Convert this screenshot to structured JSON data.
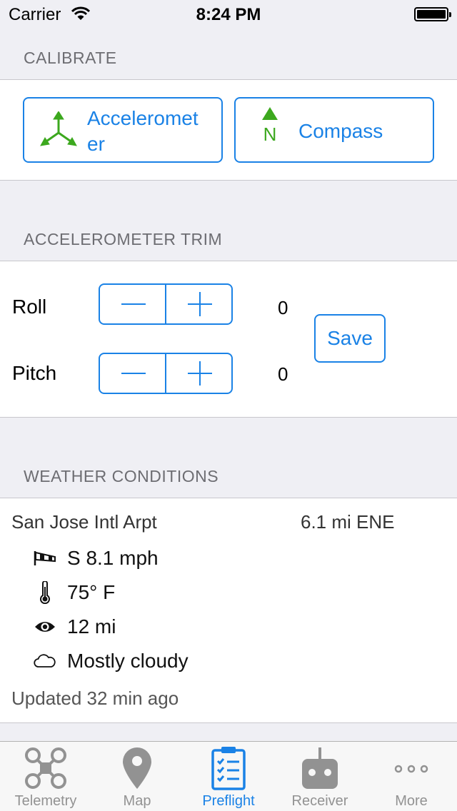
{
  "status_bar": {
    "carrier": "Carrier",
    "time": "8:24 PM"
  },
  "calibrate": {
    "header": "CALIBRATE",
    "accelerometer_line1": "Acceleromet",
    "accelerometer_line2": "er",
    "compass_label": "Compass",
    "compass_icon_letter": "N"
  },
  "trim": {
    "header": "ACCELEROMETER TRIM",
    "roll_label": "Roll",
    "roll_value": "0",
    "pitch_label": "Pitch",
    "pitch_value": "0",
    "save_label": "Save"
  },
  "weather": {
    "header": "WEATHER CONDITIONS",
    "station": "San Jose Intl Arpt",
    "distance": "6.1 mi ENE",
    "wind": "S 8.1 mph",
    "temperature": "75° F",
    "visibility": "12 mi",
    "sky": "Mostly cloudy",
    "updated": "Updated 32 min ago"
  },
  "tabs": [
    {
      "label": "Telemetry",
      "icon": "drone-icon"
    },
    {
      "label": "Map",
      "icon": "map-pin-icon"
    },
    {
      "label": "Preflight",
      "icon": "checklist-icon"
    },
    {
      "label": "Receiver",
      "icon": "remote-control-icon"
    },
    {
      "label": "More",
      "icon": "more-dots-icon"
    }
  ],
  "colors": {
    "accent": "#1a82e6",
    "icon_green": "#3ca81e",
    "inactive": "#929292"
  }
}
